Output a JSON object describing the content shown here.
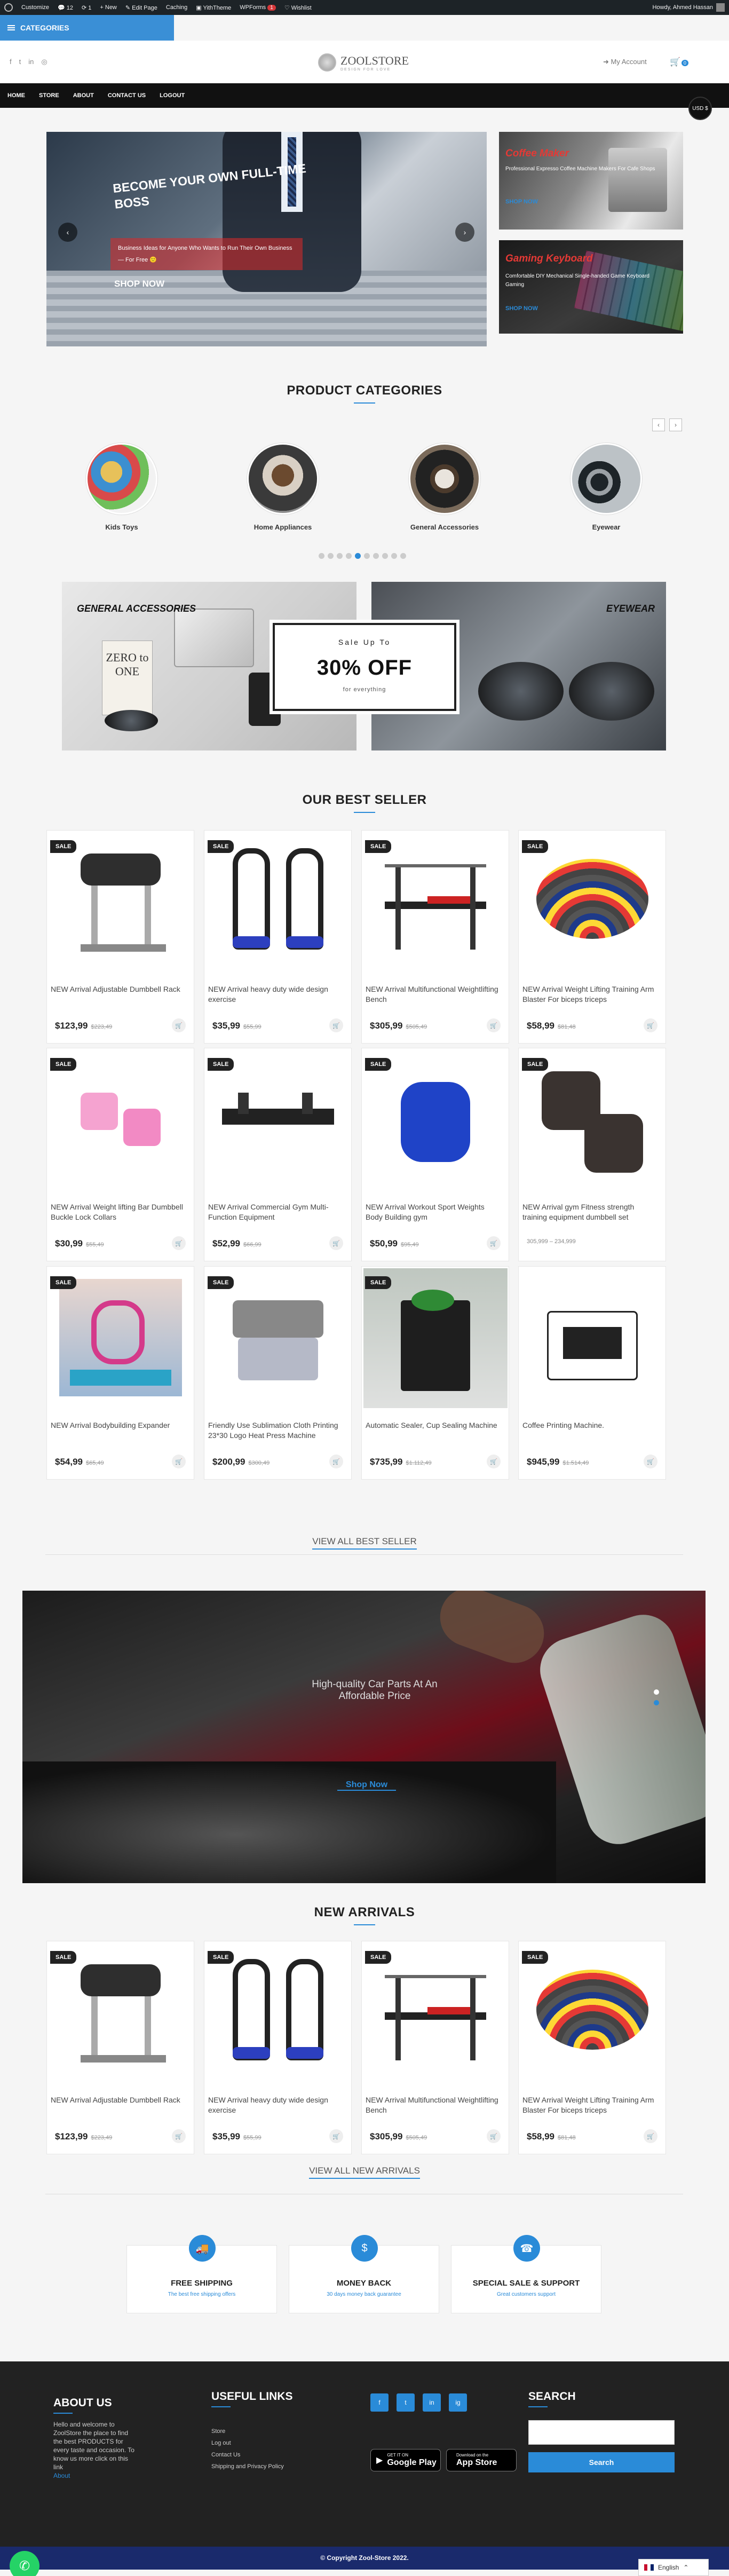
{
  "adminbar": {
    "items": [
      "Customize",
      "12",
      "1",
      "+ New",
      "Edit Page",
      "Caching",
      "YithTheme",
      "WPForms",
      "Wishlist"
    ],
    "wpforms_count": "1",
    "howdy": "Howdy, Ahmed Hassan"
  },
  "categories_button": "CATEGORIES",
  "header": {
    "logo_name": "ZOOLSTORE",
    "logo_tagline": "DESIGN FOR LOVE",
    "account": "My Account",
    "cart_count": "0"
  },
  "nav": [
    "HOME",
    "STORE",
    "ABOUT",
    "CONTACT US",
    "LOGOUT"
  ],
  "currency": "USD $",
  "hero": {
    "heading": "BECOME YOUR OWN FULL-TIME BOSS",
    "sub": "Business Ideas for Anyone Who Wants to Run Their Own Business — For Free 🙂",
    "button": "SHOP NOW"
  },
  "side_banners": [
    {
      "title": "Coffee Maker",
      "desc": "Professional Expresso Coffee Machine Makers For Cafe Shops",
      "link": "SHOP NOW"
    },
    {
      "title": "Gaming Keyboard",
      "desc": "Comfortable DIY Mechanical Single-handed Game Keyboard Gaming",
      "link": "SHOP NOW"
    }
  ],
  "product_categories": {
    "title": "PRODUCT CATEGORIES",
    "items": [
      "Kids Toys",
      "Home Appliances",
      "General Accessories",
      "Eyewear"
    ],
    "dots": 10,
    "active_dot": 4
  },
  "promo": {
    "left_title": "GENERAL ACCESSORIES",
    "right_title": "EYEWEAR",
    "offer_top": "Sale Up To",
    "offer_main": "30% OFF",
    "offer_bottom": "for everything",
    "book_text": "ZERO to ONE"
  },
  "best_seller": {
    "title": "OUR BEST SELLER",
    "view_all": "VIEW ALL BEST SELLER",
    "products": [
      {
        "title": "NEW Arrival Adjustable Dumbbell Rack",
        "price": "$123,99",
        "old": "$223,49",
        "sale": "SALE"
      },
      {
        "title": "NEW Arrival heavy duty wide design exercise",
        "price": "$35,99",
        "old": "$55,99",
        "sale": "SALE"
      },
      {
        "title": "NEW Arrival Multifunctional Weightlifting Bench",
        "price": "$305,99",
        "old": "$505,49",
        "sale": "SALE"
      },
      {
        "title": "NEW Arrival Weight Lifting Training Arm Blaster For biceps triceps",
        "price": "$58,99",
        "old": "$81,48",
        "sale": "SALE"
      },
      {
        "title": "NEW Arrival Weight lifting Bar Dumbbell Buckle Lock Collars",
        "price": "$30,99",
        "old": "$55,49",
        "sale": "SALE"
      },
      {
        "title": "NEW Arrival Commercial Gym Multi-Function Equipment",
        "price": "$52,99",
        "old": "$66,99",
        "sale": "SALE"
      },
      {
        "title": "NEW Arrival Workout Sport Weights Body Building gym",
        "price": "$50,99",
        "old": "$95,49",
        "sale": "SALE"
      },
      {
        "title": "NEW Arrival gym Fitness strength training equipment dumbbell set",
        "price": "",
        "old": "",
        "range": "305,999 – 234,999",
        "sale": "SALE"
      },
      {
        "title": "NEW Arrival Bodybuilding Expander",
        "price": "$54,99",
        "old": "$65,49",
        "sale": "SALE"
      },
      {
        "title": "Friendly Use Sublimation Cloth Printing 23*30 Logo Heat Press Machine",
        "price": "$200,99",
        "old": "$300,49",
        "sale": "SALE"
      },
      {
        "title": "Automatic Sealer, Cup Sealing Machine",
        "price": "$735,99",
        "old": "$1.112,49",
        "sale": "SALE"
      },
      {
        "title": "Coffee Printing Machine.",
        "price": "$945,99",
        "old": "$1.514,49",
        "sale": ""
      }
    ]
  },
  "car_banner": {
    "caption": "High-quality Car Parts At An Affordable Price",
    "button": "Shop Now"
  },
  "new_arrivals": {
    "title": "NEW ARRIVALS",
    "view_all": "VIEW ALL NEW ARRIVALS",
    "products": [
      {
        "title": "NEW Arrival Adjustable Dumbbell Rack",
        "price": "$123,99",
        "old": "$223,49",
        "sale": "SALE"
      },
      {
        "title": "NEW Arrival heavy duty wide design exercise",
        "price": "$35,99",
        "old": "$55,99",
        "sale": "SALE"
      },
      {
        "title": "NEW Arrival Multifunctional Weightlifting Bench",
        "price": "$305,99",
        "old": "$505,49",
        "sale": "SALE"
      },
      {
        "title": "NEW Arrival Weight Lifting Training Arm Blaster For biceps triceps",
        "price": "$58,99",
        "old": "$81,48",
        "sale": "SALE"
      }
    ]
  },
  "services": [
    {
      "title": "FREE SHIPPING",
      "desc": "The best free shipping offers"
    },
    {
      "title": "MONEY BACK",
      "desc": "30 days money back guarantee"
    },
    {
      "title": "SPECIAL SALE & SUPPORT",
      "desc": "Great customers support"
    }
  ],
  "footer": {
    "about_title": "ABOUT US",
    "about_text": "Hello and welcome to ZoolStore the place to find the best PRODUCTS for every taste and occasion. To know us more click on this link",
    "about_link": "About",
    "links_title": "USEFUL LINKS",
    "links": [
      "Store",
      "Log out",
      "Contact Us",
      "Shipping and Privacy Policy"
    ],
    "social": [
      "f",
      "t",
      "in",
      "ig"
    ],
    "google_play_top": "GET IT ON",
    "google_play": "Google Play",
    "app_store_top": "Download on the",
    "app_store": "App Store",
    "search_title": "SEARCH",
    "search_button": "Search"
  },
  "copyright": "© Copyright Zool-Store 2022.",
  "language": "English"
}
